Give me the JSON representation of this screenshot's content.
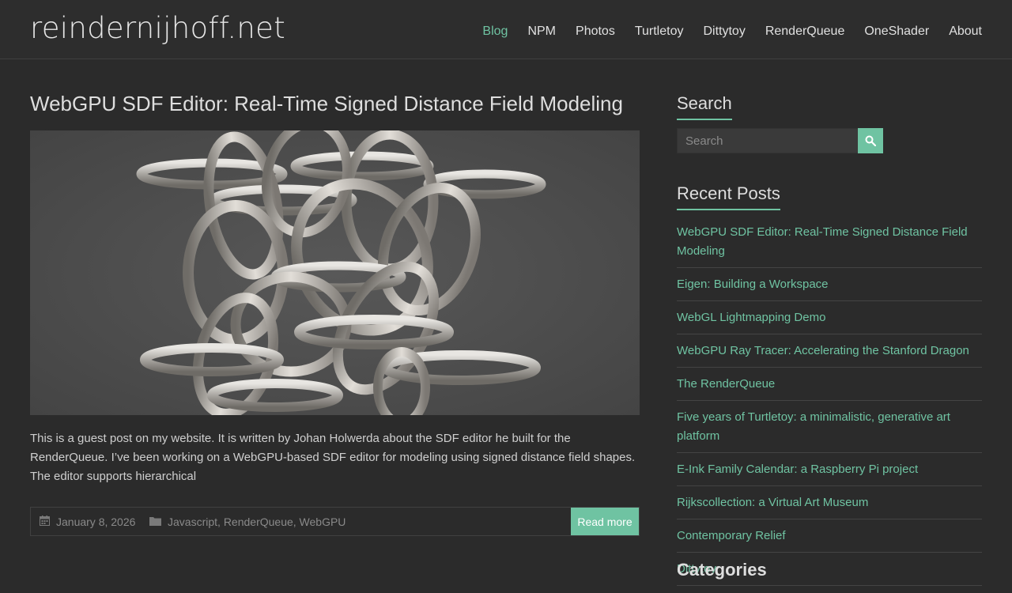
{
  "site": {
    "title": "reindernijhoff.net"
  },
  "nav": {
    "items": [
      "Blog",
      "NPM",
      "Photos",
      "Turtletoy",
      "Dittytoy",
      "RenderQueue",
      "OneShader",
      "About"
    ],
    "active": "Blog"
  },
  "post": {
    "title": "WebGPU SDF Editor: Real-Time Signed Distance Field Modeling",
    "excerpt": "This is a guest post on my website. It is written by Johan Holwerda about the SDF editor he built for the RenderQueue. I’ve been working on a WebGPU-based SDF editor for modeling using signed distance field shapes. The editor supports hierarchical",
    "date": "January 8, 2026",
    "categories": [
      "Javascript",
      "RenderQueue",
      "WebGPU"
    ],
    "read_more": "Read more",
    "date_icon": "calendar-icon",
    "category_icon": "folder-icon"
  },
  "sidebar": {
    "search_title": "Search",
    "search_placeholder": "Search",
    "search_icon": "search-icon",
    "recent_title": "Recent Posts",
    "recent_posts": [
      "WebGPU SDF Editor: Real-Time Signed Distance Field Modeling",
      "Eigen: Building a Workspace",
      "WebGL Lightmapping Demo",
      "WebGPU Ray Tracer: Accelerating the Stanford Dragon",
      "The RenderQueue",
      "Five years of Turtletoy: a minimalistic, generative art platform",
      "E-Ink Family Calendar: a Raspberry Pi project",
      "Rijkscollection: a Virtual Art Museum",
      "Contemporary Relief",
      "Dittytoy"
    ],
    "next_widget_title": "Categories"
  },
  "colors": {
    "accent": "#6fc3a2",
    "background": "#2b2b2b"
  }
}
